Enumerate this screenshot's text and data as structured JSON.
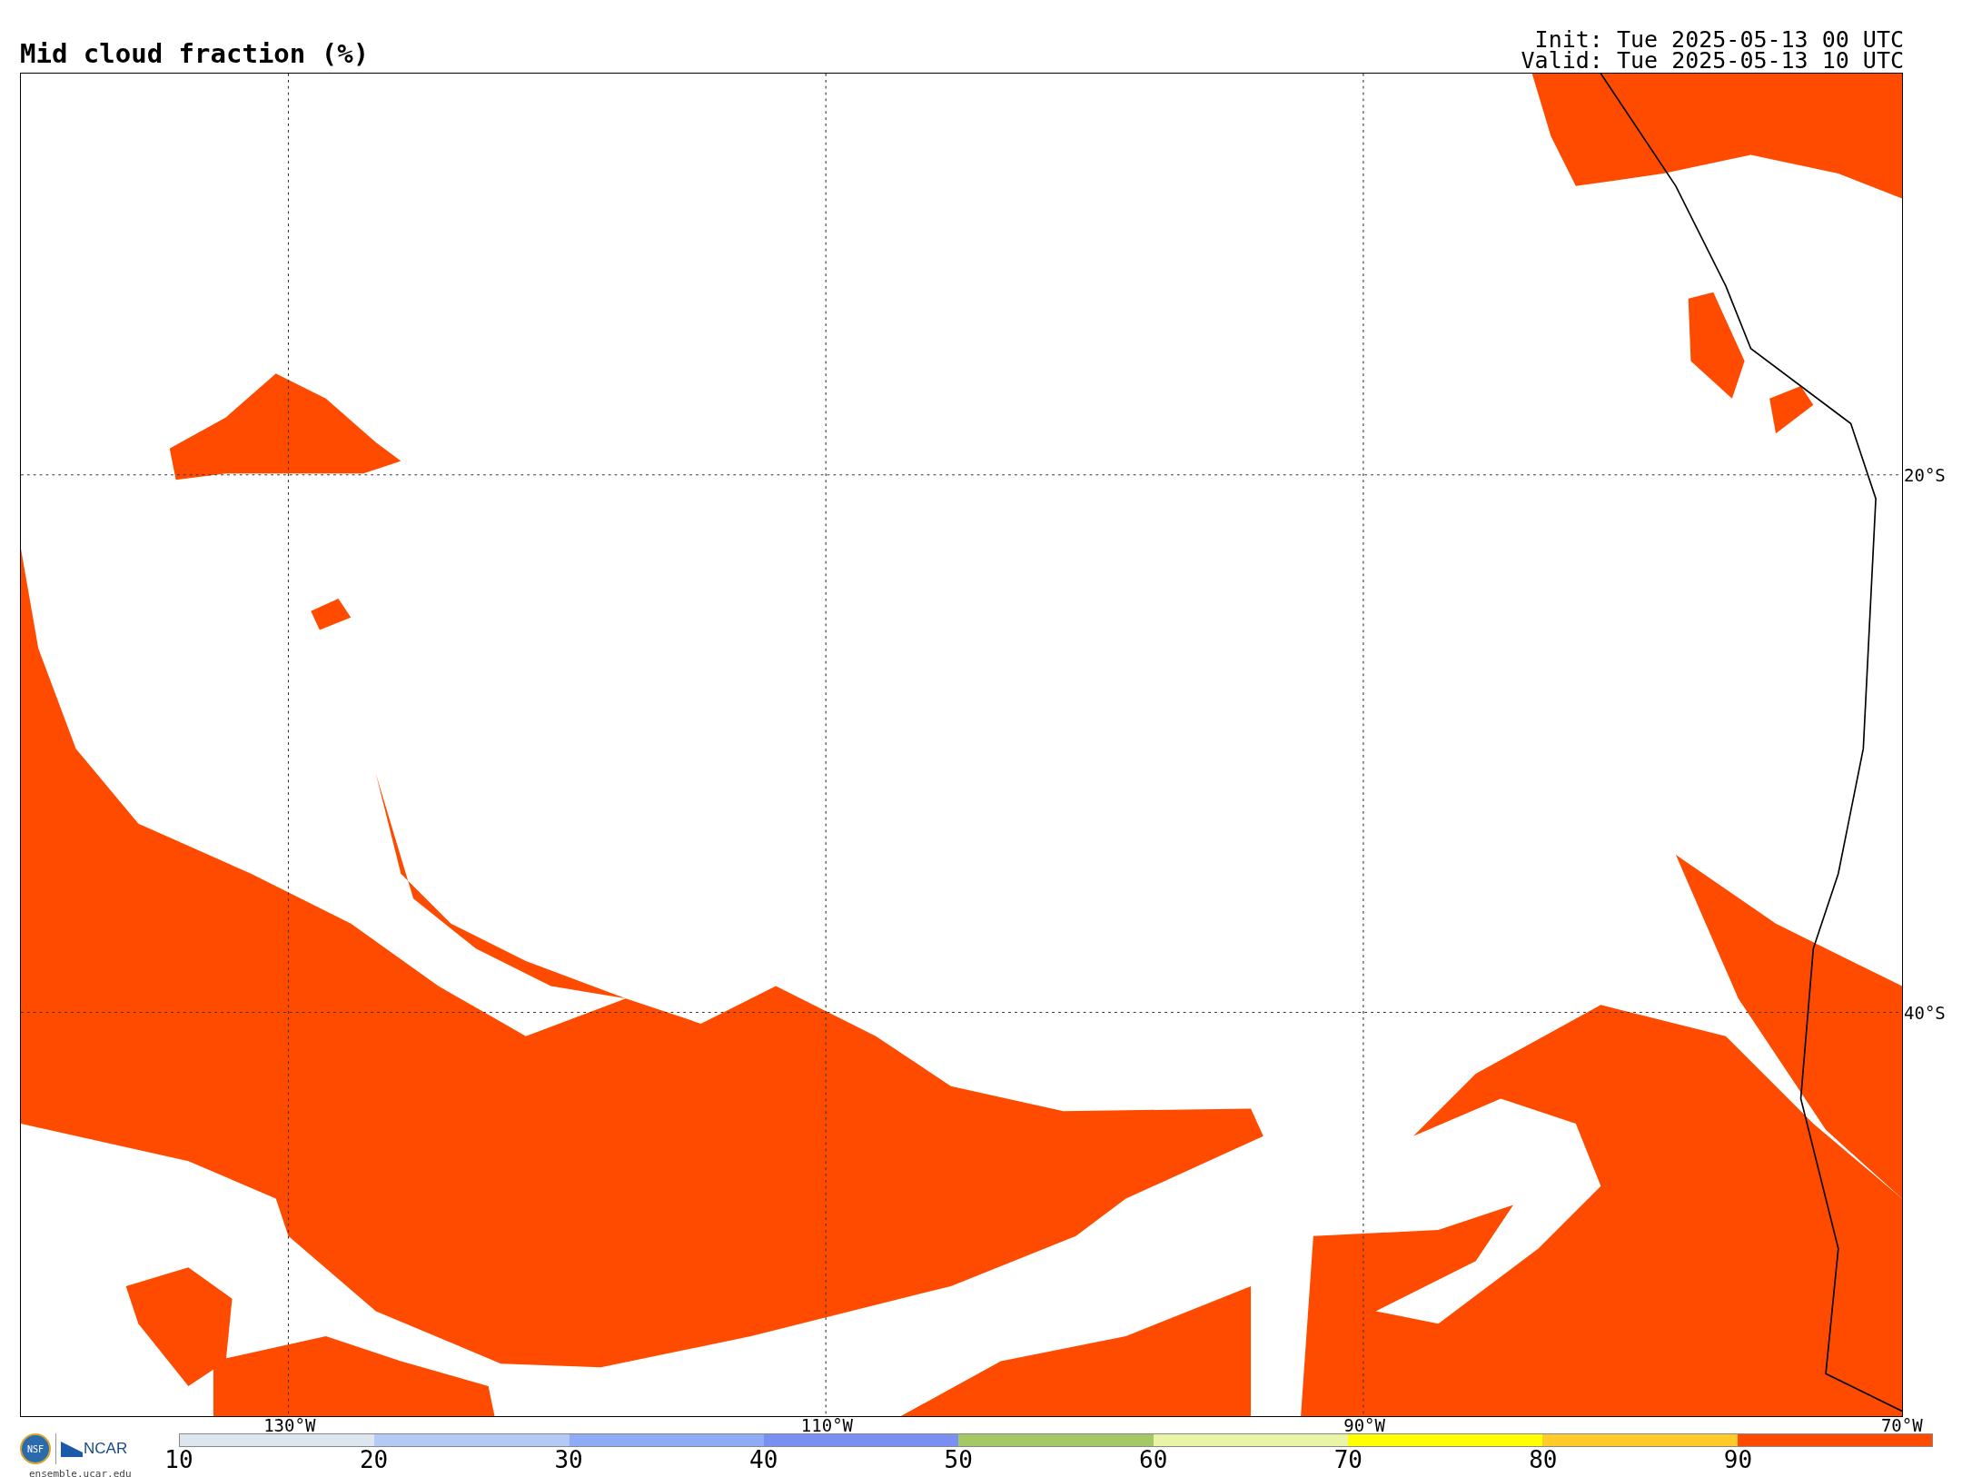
{
  "title": "Mid cloud fraction (%)",
  "init": "Init: Tue 2025-05-13 00 UTC",
  "valid": "Valid: Tue 2025-05-13 10 UTC",
  "map": {
    "lon_labels": [
      "130°W",
      "110°W",
      "90°W",
      "70°W"
    ],
    "lat_labels": [
      "20°S",
      "40°S"
    ]
  },
  "logos": {
    "nsf": "NSF",
    "ncar": "NCAR",
    "url": "ensemble.ucar.edu"
  },
  "colorbar": {
    "segments": [
      {
        "color": "#dde6ee"
      },
      {
        "color": "#b5c9f7"
      },
      {
        "color": "#8eacf5"
      },
      {
        "color": "#7a8ff2"
      },
      {
        "color": "#a3c864"
      },
      {
        "color": "#e9f5a4"
      },
      {
        "color": "#ffff00"
      },
      {
        "color": "#ffcb2b"
      },
      {
        "color": "#ff4b00"
      }
    ],
    "ticks": [
      "10",
      "20",
      "30",
      "40",
      "50",
      "60",
      "70",
      "80",
      "90"
    ]
  }
}
